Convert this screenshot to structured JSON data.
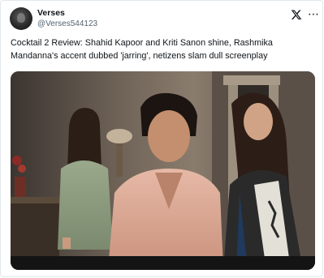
{
  "post": {
    "author_name": "Verses",
    "author_handle": "@Verses544123",
    "text": "Cocktail 2 Review: Shahid Kapoor and Kriti Sanon shine, Rashmika Mandanna's accent dubbed 'jarring', netizens slam dull screenplay"
  },
  "icons": {
    "platform": "x-logo-icon",
    "more": "more-icon",
    "avatar": "avatar"
  },
  "colors": {
    "text_primary": "#0f1419",
    "text_secondary": "#536471",
    "border": "#e1e8ed"
  }
}
